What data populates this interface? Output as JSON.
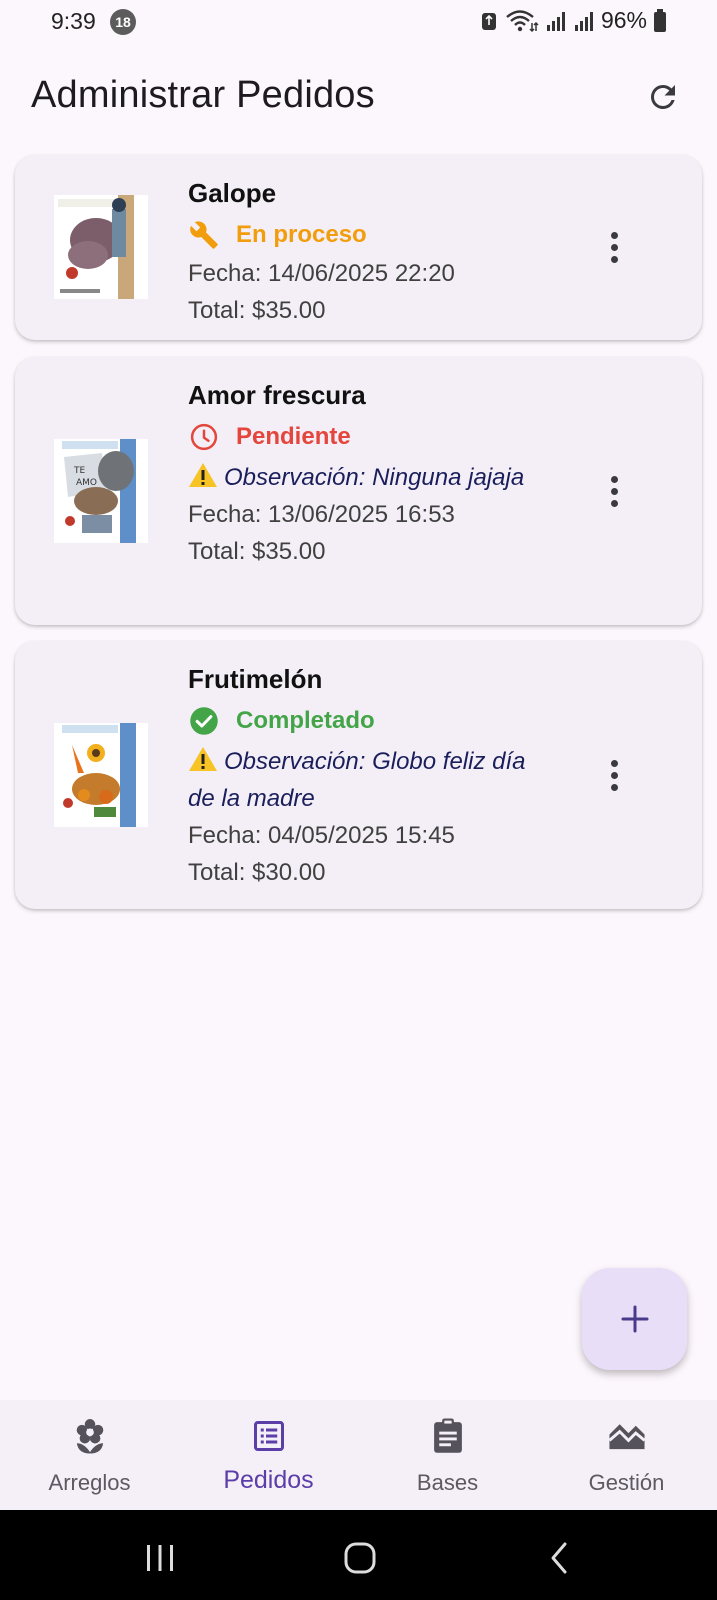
{
  "status_bar": {
    "time": "9:39",
    "notification_count": "18",
    "battery_percent": "96%"
  },
  "header": {
    "title": "Administrar Pedidos",
    "refresh_icon": "refresh-icon"
  },
  "orders": [
    {
      "name": "Galope",
      "status": "En proceso",
      "status_icon": "wrench-icon",
      "status_color": "#f29d0e",
      "observation": "",
      "date": "Fecha: 14/06/2025 22:20",
      "total": "Total: $35.00"
    },
    {
      "name": "Amor frescura",
      "status": "Pendiente",
      "status_icon": "clock-icon",
      "status_color": "#e5463c",
      "observation": "Observación: Ninguna jajaja",
      "date": "Fecha: 13/06/2025 16:53",
      "total": "Total: $35.00"
    },
    {
      "name": "Frutimelón",
      "status": "Completado",
      "status_icon": "check-circle-icon",
      "status_color": "#43a547",
      "observation": "Observación: Globo feliz día de la madre",
      "date": "Fecha: 04/05/2025 15:45",
      "total": "Total: $30.00"
    }
  ],
  "fab": {
    "icon": "plus-icon"
  },
  "bottom_nav": {
    "items": [
      {
        "label": "Arreglos",
        "icon": "flower-icon",
        "active": false
      },
      {
        "label": "Pedidos",
        "icon": "list-icon",
        "active": true
      },
      {
        "label": "Bases",
        "icon": "clipboard-icon",
        "active": false
      },
      {
        "label": "Gestión",
        "icon": "landscape-icon",
        "active": false
      }
    ]
  },
  "colors": {
    "accent": "#5b3ea8",
    "fab_background": "#e8def8",
    "card_background": "#f4eff6",
    "observation_text": "#1a1f5c"
  }
}
